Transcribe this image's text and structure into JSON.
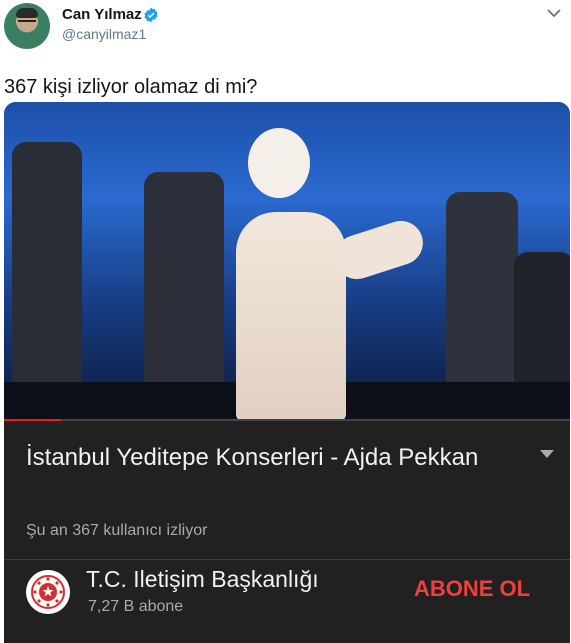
{
  "tweet": {
    "display_name": "Can Yılmaz",
    "handle": "@canyilmaz1",
    "text": "367 kişi izliyor olamaz di mi?",
    "verified_icon": "verified-badge-icon",
    "menu_icon": "chevron-down-icon",
    "colors": {
      "verified": "#1da1f2",
      "text": "#14171a",
      "muted": "#657786"
    }
  },
  "video_card": {
    "title": "İstanbul Yeditepe Konserleri - Ajda Pekkan",
    "viewers": "Şu an 367 kullanıcı izliyor",
    "progress_fraction": 0.1,
    "expand_icon": "expand-chevron-icon",
    "channel": {
      "name": "T.C. Iletişim Başkanlığı",
      "subscribers": "7,27 B abone",
      "subscribe_label": "ABONE OL",
      "logo_icon": "channel-emblem-icon"
    },
    "colors": {
      "background": "#212121",
      "accent": "#f13f3c",
      "progress": "#e62117"
    }
  }
}
